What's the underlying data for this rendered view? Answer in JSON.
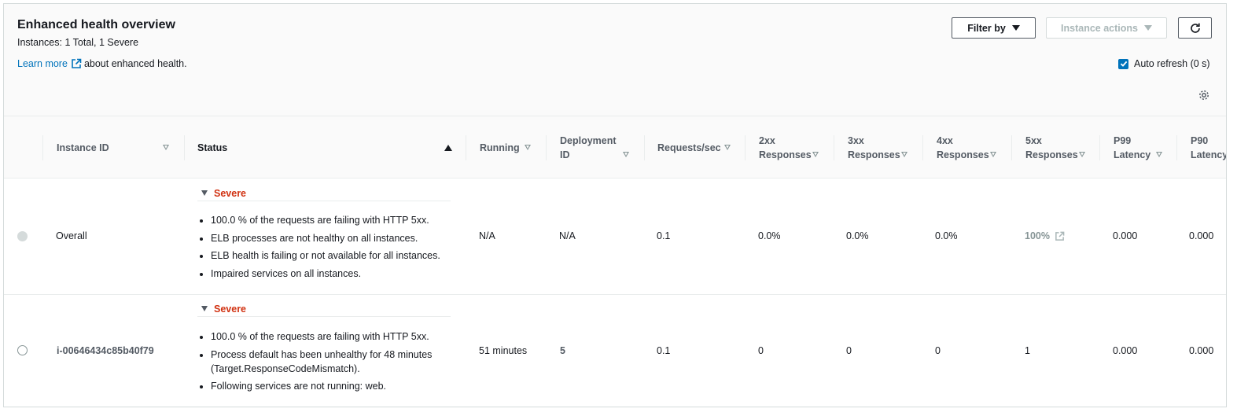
{
  "header": {
    "title": "Enhanced health overview",
    "instances_summary": "Instances: 1 Total, 1 Severe",
    "learn_more": "Learn more",
    "learn_more_suffix": "about enhanced health.",
    "filter_label": "Filter by",
    "actions_label": "Instance actions",
    "auto_refresh_label": "Auto refresh (0 s)",
    "auto_refresh_checked": true
  },
  "columns": {
    "instance_id": "Instance ID",
    "status": "Status",
    "running": "Running",
    "deployment_line1": "Deployment",
    "deployment_line2": "ID",
    "requests": "Requests/sec",
    "r2xx_line1": "2xx",
    "r2xx_line2": "Responses",
    "r3xx_line1": "3xx",
    "r3xx_line2": "Responses",
    "r4xx_line1": "4xx",
    "r4xx_line2": "Responses",
    "r5xx_line1": "5xx",
    "r5xx_line2": "Responses",
    "p99_line1": "P99",
    "p99_line2": "Latency",
    "p90_line1": "P90",
    "p90_line2": "Latency"
  },
  "rows": [
    {
      "instance_id": "Overall",
      "status": "Severe",
      "causes": [
        "100.0 % of the requests are failing with HTTP 5xx.",
        "ELB processes are not healthy on all instances.",
        "ELB health is failing or not available for all instances.",
        "Impaired services on all instances."
      ],
      "running": "N/A",
      "deployment_id": "N/A",
      "requests": "0.1",
      "r2xx": "0.0%",
      "r3xx": "0.0%",
      "r4xx": "0.0%",
      "r5xx": "100%",
      "p99": "0.000",
      "p90": "0.000"
    },
    {
      "instance_id": "i-00646434c85b40f79",
      "status": "Severe",
      "causes": [
        "100.0 % of the requests are failing with HTTP 5xx.",
        "Process default has been unhealthy for 48 minutes (Target.ResponseCodeMismatch).",
        "Following services are not running: web."
      ],
      "running": "51 minutes",
      "deployment_id": "5",
      "requests": "0.1",
      "r2xx": "0",
      "r3xx": "0",
      "r4xx": "0",
      "r5xx": "1",
      "p99": "0.000",
      "p90": "0.000"
    }
  ],
  "colors": {
    "severe": "#d13212",
    "link": "#0073bb",
    "accent": "#0073bb"
  },
  "icons": [
    "external-link-icon",
    "caret-down-icon",
    "refresh-icon",
    "gear-icon",
    "sort-ascending-icon",
    "sort-descending-icon"
  ]
}
